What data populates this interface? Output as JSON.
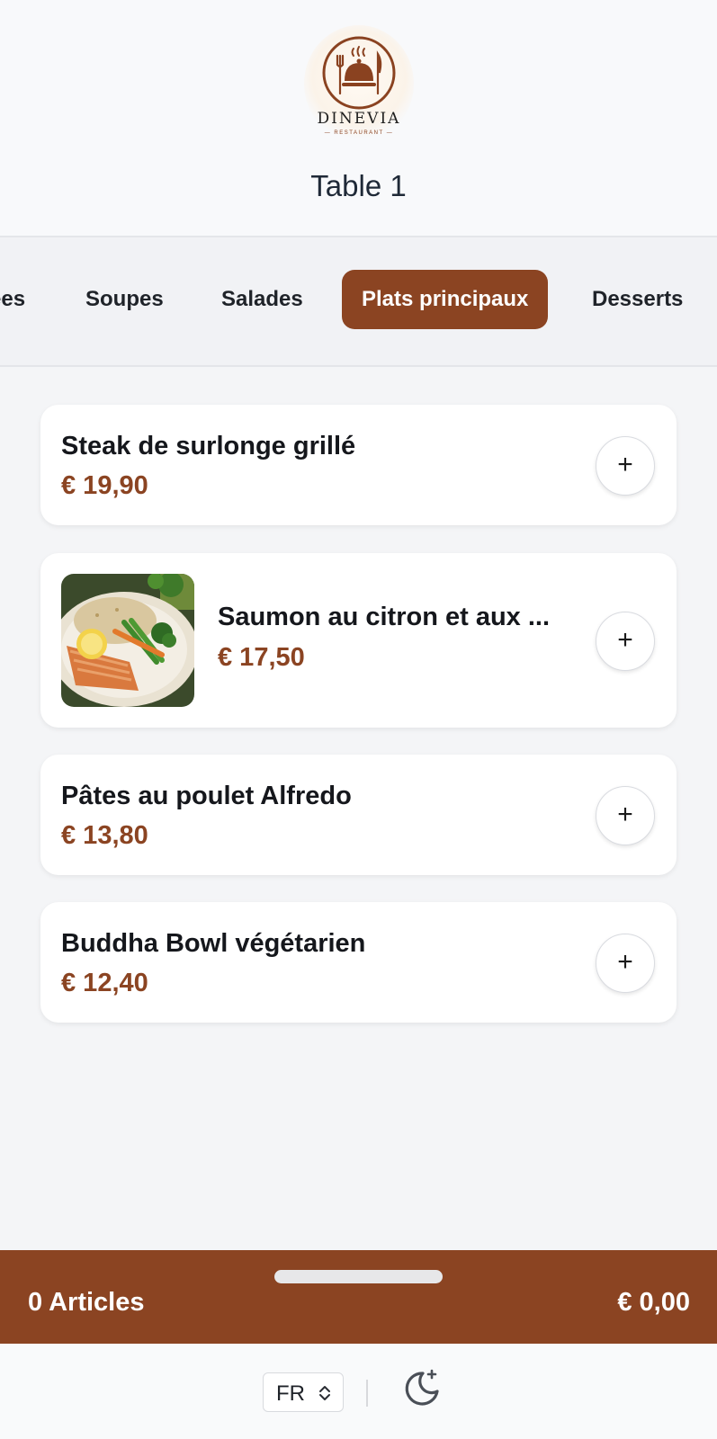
{
  "header": {
    "logo": {
      "name": "DINEVIA",
      "subtitle": "— RESTAURANT —"
    },
    "table_title": "Table 1"
  },
  "tabs": [
    {
      "label": "ées",
      "active": false
    },
    {
      "label": "Soupes",
      "active": false
    },
    {
      "label": "Salades",
      "active": false
    },
    {
      "label": "Plats principaux",
      "active": true
    },
    {
      "label": "Desserts",
      "active": false
    }
  ],
  "menu": {
    "items": [
      {
        "name": "Steak de surlonge grillé",
        "price": "€ 19,90",
        "has_image": false
      },
      {
        "name": "Saumon au citron et aux ...",
        "price": "€ 17,50",
        "has_image": true
      },
      {
        "name": "Pâtes au poulet Alfredo",
        "price": "€ 13,80",
        "has_image": false
      },
      {
        "name": "Buddha Bowl végétarien",
        "price": "€ 12,40",
        "has_image": false
      }
    ],
    "add_icon": "plus-icon"
  },
  "cart": {
    "count_label": "0 Articles",
    "total": "€ 0,00"
  },
  "footer": {
    "language": "FR",
    "theme_icon": "moon-stars-icon"
  },
  "colors": {
    "accent": "#8b4422",
    "background": "#f4f5f7",
    "card": "#ffffff",
    "text": "#16181d"
  }
}
